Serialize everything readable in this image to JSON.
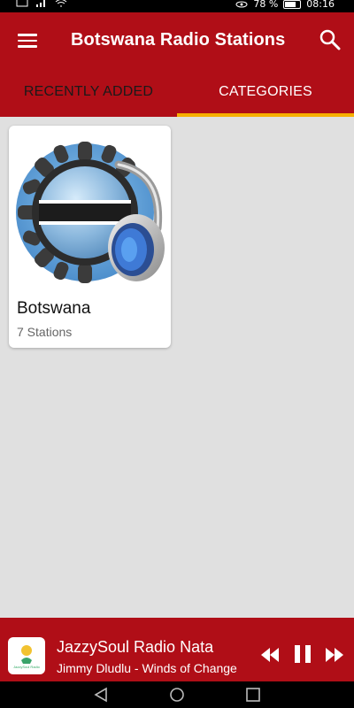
{
  "status_bar": {
    "battery_text": "78 %",
    "time": "08:16"
  },
  "app_bar": {
    "title": "Botswana Radio Stations",
    "menu_icon": "hamburger-icon",
    "search_icon": "search-icon"
  },
  "tabs": [
    {
      "label": "RECENTLY ADDED",
      "selected": false
    },
    {
      "label": "CATEGORIES",
      "selected": true
    }
  ],
  "categories": [
    {
      "title": "Botswana",
      "subtitle": "7 Stations",
      "icon": "botswana-radio-headphones-icon"
    }
  ],
  "now_playing": {
    "station": "JazzySoul Radio Nata",
    "track": "Jimmy Dludlu - Winds of Change",
    "thumb_caption": "JazzySoul Radio",
    "controls": [
      "rewind-icon",
      "pause-icon",
      "fast-forward-icon"
    ]
  },
  "colors": {
    "primary": "#b00e17",
    "tab_indicator": "#f7b000",
    "background": "#e0e0e0"
  }
}
